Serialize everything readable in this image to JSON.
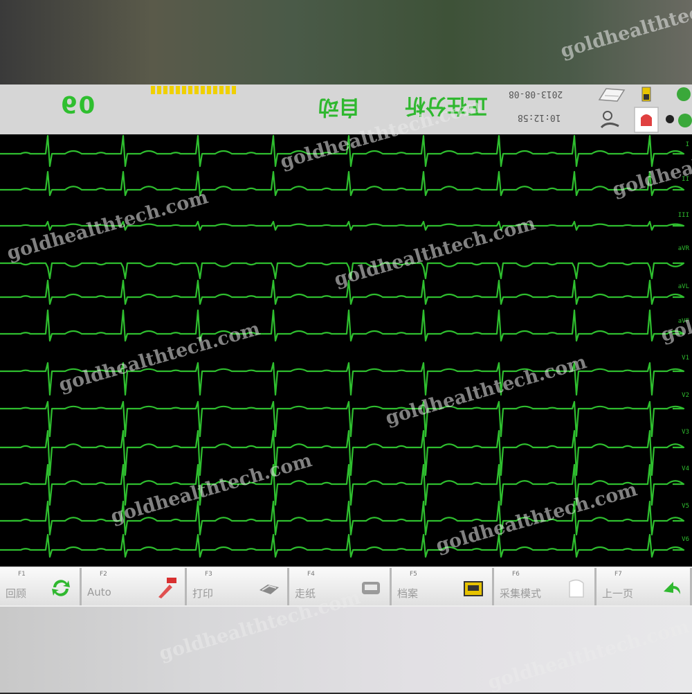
{
  "header": {
    "heart_rate": "60",
    "mode_label": "自动",
    "analysis_label": "正在分析",
    "date": "2013-08-08",
    "time": "10:12:58"
  },
  "toolbar": {
    "buttons": [
      {
        "key": "F1",
        "label": "回顾",
        "icon": "refresh-icon"
      },
      {
        "key": "F2",
        "label": "Auto",
        "icon": "pen-icon"
      },
      {
        "key": "F3",
        "label": "打印",
        "icon": "print-icon"
      },
      {
        "key": "F4",
        "label": "走纸",
        "icon": "paper-icon"
      },
      {
        "key": "F5",
        "label": "档案",
        "icon": "folder-icon"
      },
      {
        "key": "F6",
        "label": "采集模式",
        "icon": "sheet-icon"
      },
      {
        "key": "F7",
        "label": "上一页",
        "icon": "arrow-icon"
      }
    ]
  },
  "lead_scale": [
    "I",
    "II",
    "III",
    "aVR",
    "aVL",
    "aVF",
    "V1",
    "V2",
    "V3",
    "V4",
    "V5",
    "V6"
  ],
  "watermark": "goldhealthtech.com",
  "colors": {
    "trace": "#2fbf2f",
    "background": "#000000",
    "header": "#d6d6d6",
    "signal": "#f0d000"
  }
}
